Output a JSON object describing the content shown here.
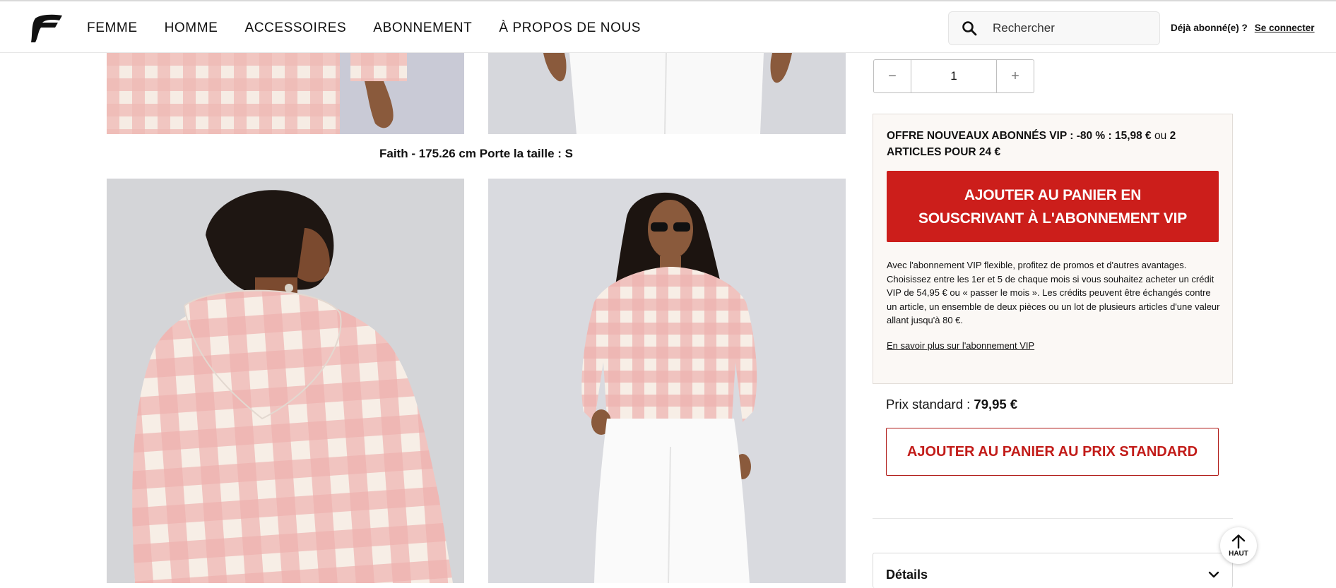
{
  "header": {
    "logo_icon": "brand-f-logo",
    "nav": [
      "FEMME",
      "HOMME",
      "ACCESSOIRES",
      "ABONNEMENT",
      "À PROPOS DE NOUS"
    ],
    "search": {
      "placeholder": "Rechercher",
      "icon": "search-icon"
    },
    "account": {
      "already": "Déjà abonné(e) ?",
      "login": "Se connecter"
    }
  },
  "gallery": {
    "caption": "Faith - 175.26 cm Porte la taille : S",
    "colors": {
      "check_pink": "#eab1ae",
      "cream": "#f6ece4",
      "background": "#d9dadf",
      "skin": "#8a5a3c"
    }
  },
  "product": {
    "quantity": {
      "minus": "−",
      "value": "1",
      "plus": "+"
    },
    "vip": {
      "offer_bold": "OFFRE NOUVEAUX ABONNÉS VIP : -80 %  : 15,98 €",
      "offer_or": "ou",
      "offer_bold2": "2 ARTICLES POUR 24 €",
      "button": "AJOUTER AU PANIER EN SOUSCRIVANT À L'ABONNEMENT VIP",
      "description": "Avec l'abonnement VIP flexible, profitez de promos et d'autres avantages. Choisissez entre les 1er et 5 de chaque mois si vous souhaitez acheter un crédit VIP de 54,95 € ou « passer le mois ». Les crédits peuvent être échangés contre un article, un ensemble de deux pièces ou un lot de plusieurs articles d'une valeur allant jusqu'à 80 €.",
      "link": "En savoir plus sur l'abonnement VIP"
    },
    "standard": {
      "label": "Prix standard :",
      "price": "79,95 €",
      "button": "AJOUTER AU PANIER AU PRIX STANDARD"
    },
    "details_label": "Détails"
  },
  "back_to_top": "HAUT",
  "colors": {
    "vip_red": "#cc1e1b",
    "vip_box_bg": "#fbf8f5"
  }
}
